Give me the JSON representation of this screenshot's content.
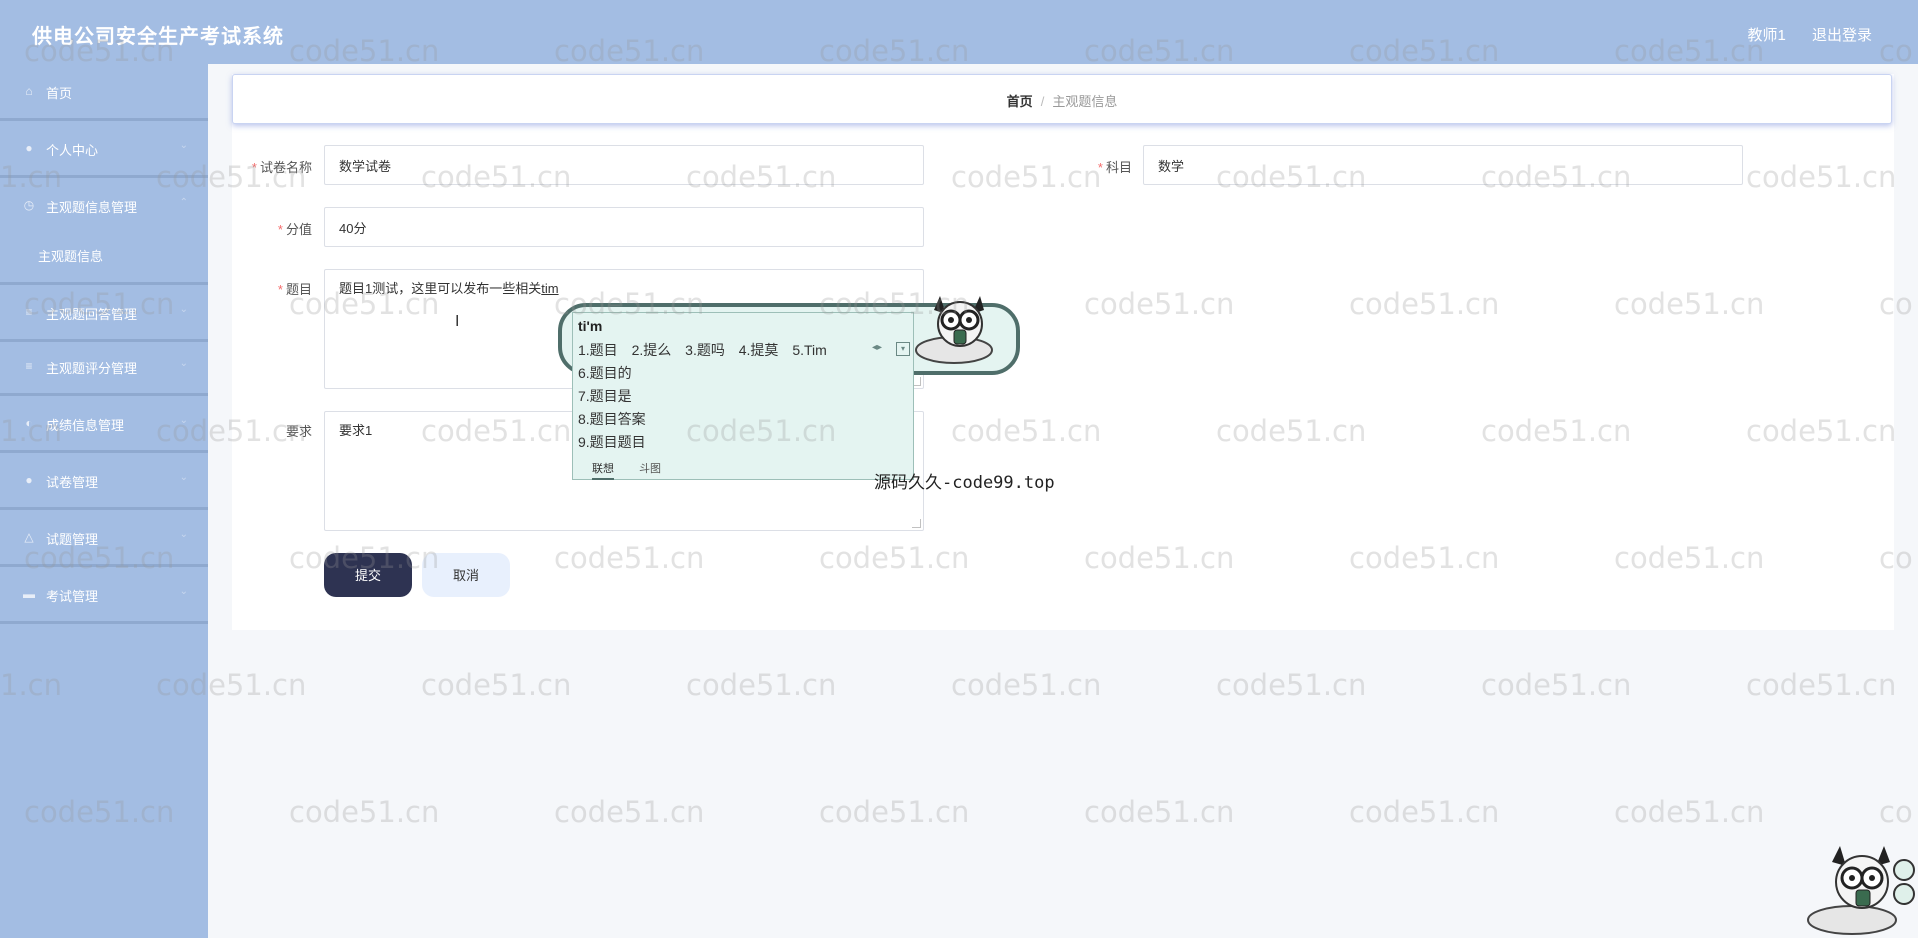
{
  "header": {
    "app_title": "供电公司安全生产考试系统",
    "user_label": "教师1",
    "logout_label": "退出登录"
  },
  "sidebar": {
    "items": [
      {
        "label": "首页",
        "icon": "home-icon"
      },
      {
        "label": "个人中心",
        "icon": "user-icon"
      },
      {
        "label": "主观题信息管理",
        "icon": "clock-icon"
      },
      {
        "label": "主观题回答管理",
        "icon": "list-icon"
      },
      {
        "label": "主观题评分管理",
        "icon": "list-icon"
      },
      {
        "label": "成绩信息管理",
        "icon": "chart-icon"
      },
      {
        "label": "试卷管理",
        "icon": "user-icon"
      },
      {
        "label": "试题管理",
        "icon": "bell-icon"
      },
      {
        "label": "考试管理",
        "icon": "monitor-icon"
      }
    ],
    "sub_item": "主观题信息"
  },
  "breadcrumb": {
    "home": "首页",
    "separator": "/",
    "current": "主观题信息"
  },
  "form": {
    "paper_name_label": "试卷名称",
    "paper_name_value": "数学试卷",
    "subject_label": "科目",
    "subject_value": "数学",
    "score_label": "分值",
    "score_value": "40分",
    "question_label": "题目",
    "question_value": "题目1测试，这里可以发布一些相关",
    "question_composing": "tim",
    "requirement_label": "要求",
    "requirement_value": "要求1",
    "required_mark": "*"
  },
  "buttons": {
    "submit": "提交",
    "cancel": "取消"
  },
  "ime": {
    "pinyin": "ti'm",
    "row_candidates": [
      "1.题目",
      "2.提么",
      "3.题吗",
      "4.提莫",
      "5.Tim"
    ],
    "list_candidates": [
      "6.题目的",
      "7.题目是",
      "8.题目答案",
      "9.题目题目"
    ],
    "tabs": [
      "联想",
      "斗图"
    ],
    "nav_arrows": "◂▸",
    "dropdown": "▾"
  },
  "overlay_caption": "源码久久-code99.top",
  "watermark_text": "code51.cn",
  "partial_watermark": "1.cn",
  "cursor_glyph": "I",
  "colors": {
    "header_bg": "#a3bde3",
    "sidebar_bg": "#a3bde3",
    "primary_button": "#2e3352",
    "required": "#f56c6c"
  }
}
